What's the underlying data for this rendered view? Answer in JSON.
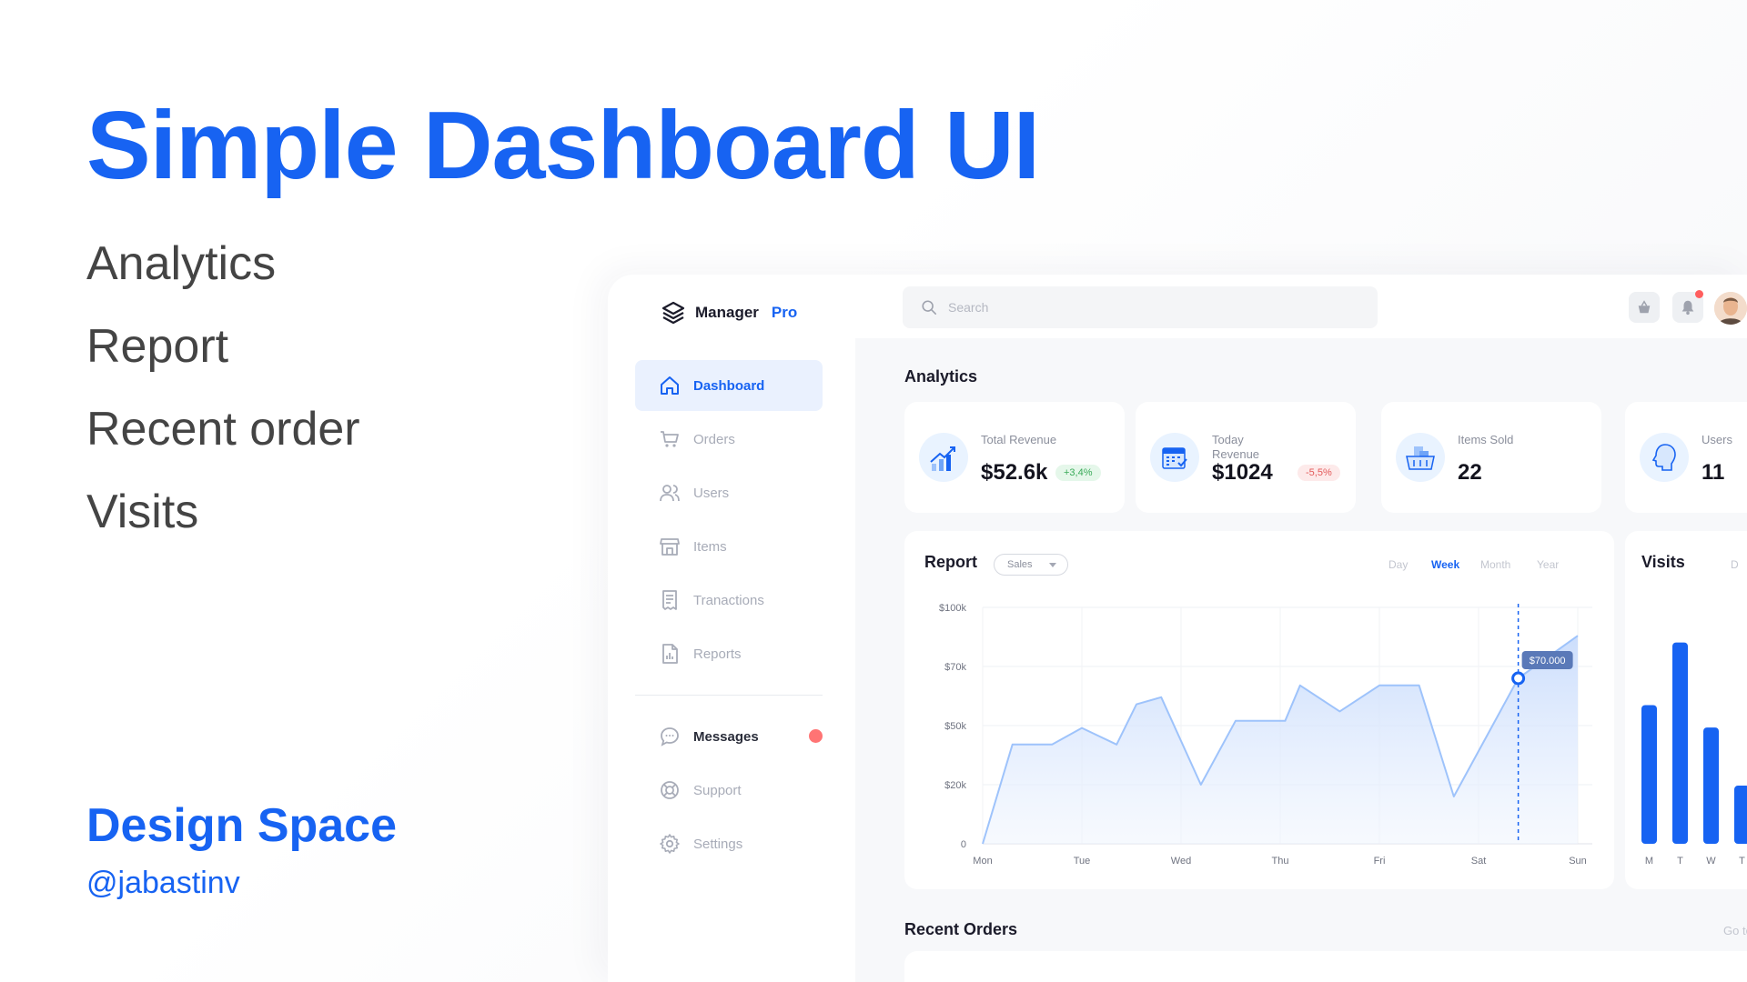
{
  "promo": {
    "title": "Simple Dashboard UI",
    "features": [
      "Analytics",
      "Report",
      "Recent order",
      "Visits"
    ],
    "brand": "Design Space",
    "handle": "@jabastinv"
  },
  "app": {
    "logo": {
      "name": "Manager",
      "accent": "Pro"
    },
    "nav": [
      {
        "label": "Dashboard",
        "icon": "home-icon",
        "active": true
      },
      {
        "label": "Orders",
        "icon": "cart-icon"
      },
      {
        "label": "Users",
        "icon": "users-icon"
      },
      {
        "label": "Items",
        "icon": "store-icon"
      },
      {
        "label": "Tranactions",
        "icon": "receipt-icon"
      },
      {
        "label": "Reports",
        "icon": "report-icon"
      }
    ],
    "nav_secondary": [
      {
        "label": "Messages",
        "icon": "chat-icon",
        "unread": true
      },
      {
        "label": "Support",
        "icon": "lifebuoy-icon"
      },
      {
        "label": "Settings",
        "icon": "gear-icon"
      }
    ],
    "search": {
      "placeholder": "Search"
    },
    "analytics": {
      "title": "Analytics",
      "cards": [
        {
          "label": "Total Revenue",
          "value": "$52.6k",
          "change": "+3,4%",
          "trend": "up",
          "icon": "revenue-chart-icon"
        },
        {
          "label": "Today Revenue",
          "value": "$1024",
          "change": "-5,5%",
          "trend": "down",
          "icon": "calendar-icon"
        },
        {
          "label": "Items Sold",
          "value": "22",
          "icon": "basket-icon"
        },
        {
          "label": "Users",
          "value": "11",
          "icon": "head-icon"
        }
      ]
    },
    "report": {
      "title": "Report",
      "filter": "Sales",
      "ranges": [
        "Day",
        "Week",
        "Month",
        "Year"
      ],
      "active_range": "Week",
      "tooltip": "$70.000"
    },
    "visits": {
      "title": "Visits",
      "range_label": "D"
    },
    "recent_orders": {
      "title": "Recent Orders",
      "link": "Go to Orders"
    },
    "colors": {
      "accent": "#1763f2",
      "accent_light": "#eaf1fe",
      "danger": "#ff7474",
      "success": "#3aab59"
    }
  },
  "chart_data": [
    {
      "type": "area",
      "title": "Report",
      "x": [
        "Mon",
        "Tue",
        "Wed",
        "Thu",
        "Fri",
        "Sat",
        "Sun"
      ],
      "y_ticks": [
        "0",
        "$20k",
        "$50k",
        "$70k",
        "$100k"
      ],
      "ylim": [
        0,
        100000
      ],
      "series": [
        {
          "points": [
            [
              0,
              0
            ],
            [
              0.3,
              42000
            ],
            [
              0.7,
              42000
            ],
            [
              1.0,
              49000
            ],
            [
              1.35,
              42000
            ],
            [
              1.55,
              59000
            ],
            [
              1.8,
              62000
            ],
            [
              2.2,
              25000
            ],
            [
              2.55,
              52000
            ],
            [
              3.05,
              52000
            ],
            [
              3.2,
              67000
            ],
            [
              3.6,
              56000
            ],
            [
              4.0,
              67000
            ],
            [
              4.4,
              67000
            ],
            [
              4.75,
              20000
            ],
            [
              5.4,
              70000
            ],
            [
              6.0,
              88000
            ]
          ]
        }
      ],
      "highlight": {
        "x": 5.4,
        "y": 70000,
        "label": "$70.000"
      },
      "grid": true
    },
    {
      "type": "bar",
      "title": "Visits",
      "categories": [
        "M",
        "T",
        "W",
        "T"
      ],
      "values": [
        62,
        90,
        52,
        26
      ]
    }
  ]
}
